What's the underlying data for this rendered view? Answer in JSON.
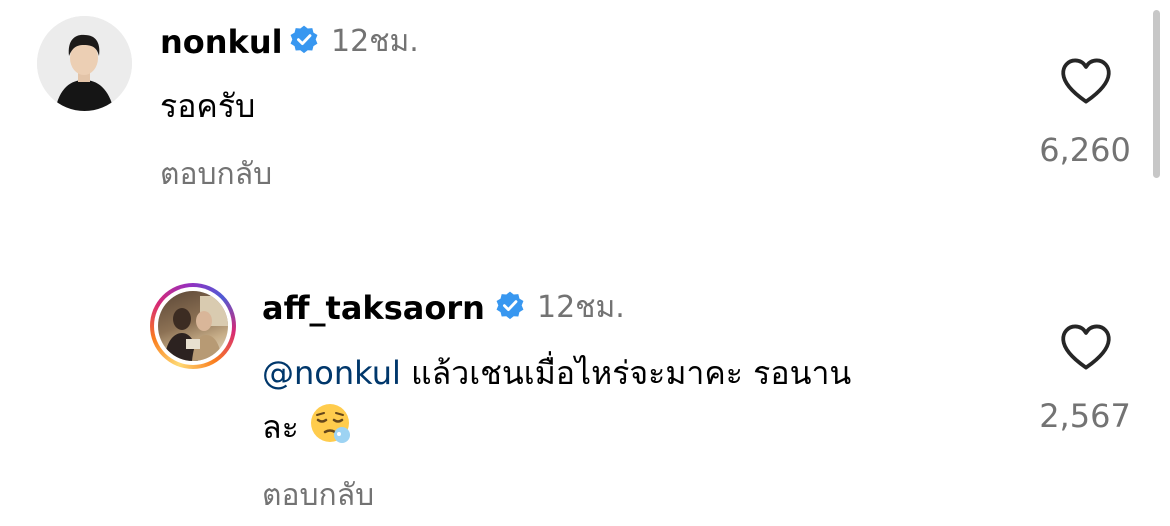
{
  "comments": [
    {
      "username": "nonkul",
      "time": "12ชม.",
      "text": "รอครับ",
      "reply_label": "ตอบกลับ",
      "likes": "6,260",
      "verified": true
    },
    {
      "username": "aff_taksaorn",
      "time": "12ชม.",
      "mention": "@nonkul",
      "text_line1": " แล้วเชนเมื่อไหร่จะมาคะ รอนาน",
      "text_line2": "ละ",
      "emoji": "sleepy-face-emoji",
      "reply_label": "ตอบกลับ",
      "likes": "2,567",
      "verified": true,
      "story_ring": true
    }
  ],
  "colors": {
    "verified": "#3897f0",
    "secondary_text": "#737373",
    "mention": "#00376b"
  }
}
